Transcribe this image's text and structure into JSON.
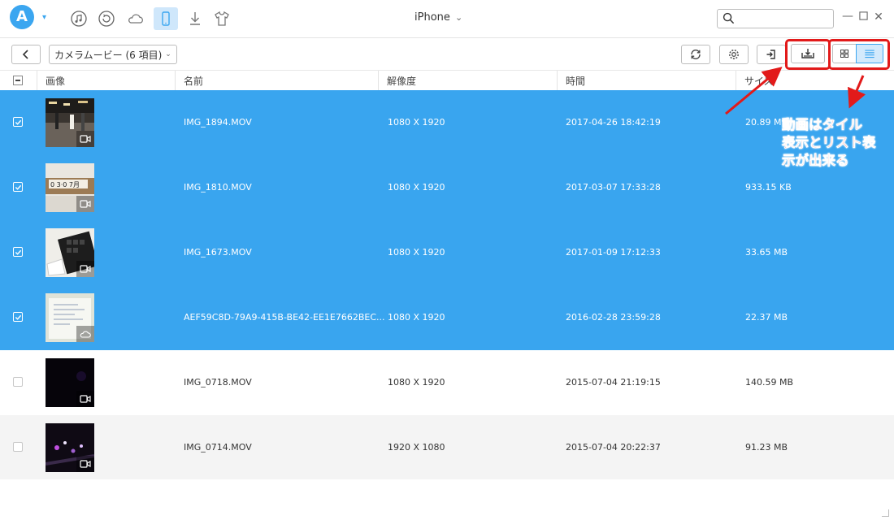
{
  "app": {
    "logo_letter": "A",
    "device_name": "iPhone",
    "device_caret": "⌄",
    "search_placeholder": "",
    "nav_icons": [
      "music-icon",
      "restore-icon",
      "icloud-icon",
      "iphone-icon",
      "download-icon",
      "tshirt-icon"
    ],
    "window_controls": [
      "minimize",
      "maximize",
      "close"
    ]
  },
  "toolbar": {
    "back_icon": "chevron-left-icon",
    "category_label": "カメラムービー (6 項目)",
    "category_caret": "⌄",
    "right_buttons": [
      "refresh-icon",
      "settings-icon",
      "import-icon",
      "export-to-pc-icon",
      "grid-view-icon",
      "list-view-icon"
    ]
  },
  "table": {
    "columns": [
      "画像",
      "名前",
      "解像度",
      "時間",
      "サイズ"
    ],
    "rows": [
      {
        "selected": true,
        "thumb": "street",
        "badge": "video",
        "name": "IMG_1894.MOV",
        "resolution": "1080 X 1920",
        "time": "2017-04-26 18:42:19",
        "size": "20.89 MB"
      },
      {
        "selected": true,
        "thumb": "block",
        "badge": "video",
        "name": "IMG_1810.MOV",
        "resolution": "1080 X 1920",
        "time": "2017-03-07 17:33:28",
        "size": "933.15 KB"
      },
      {
        "selected": true,
        "thumb": "keyboard",
        "badge": "video",
        "name": "IMG_1673.MOV",
        "resolution": "1080 X 1920",
        "time": "2017-01-09 17:12:33",
        "size": "33.65 MB"
      },
      {
        "selected": true,
        "thumb": "paper",
        "badge": "cloud",
        "name": "AEF59C8D-79A9-415B-BE42-EE1E7662BEC...",
        "resolution": "1080 X 1920",
        "time": "2016-02-28 23:59:28",
        "size": "22.37 MB"
      },
      {
        "selected": false,
        "thumb": "dark",
        "badge": "video",
        "name": "IMG_0718.MOV",
        "resolution": "1080 X 1920",
        "time": "2015-07-04 21:19:15",
        "size": "140.59 MB"
      },
      {
        "selected": false,
        "thumb": "lights",
        "badge": "video",
        "name": "IMG_0714.MOV",
        "resolution": "1920 X 1080",
        "time": "2015-07-04 20:22:37",
        "size": "91.23 MB"
      }
    ]
  },
  "annotation": {
    "lines": [
      "動画はタイル",
      "表示とリスト表",
      "示が出来る"
    ],
    "color": "#ff2d1f"
  },
  "colors": {
    "selection": "#39a5ef",
    "accent": "#3ba6f0",
    "highlight_box": "#e21a1a"
  }
}
